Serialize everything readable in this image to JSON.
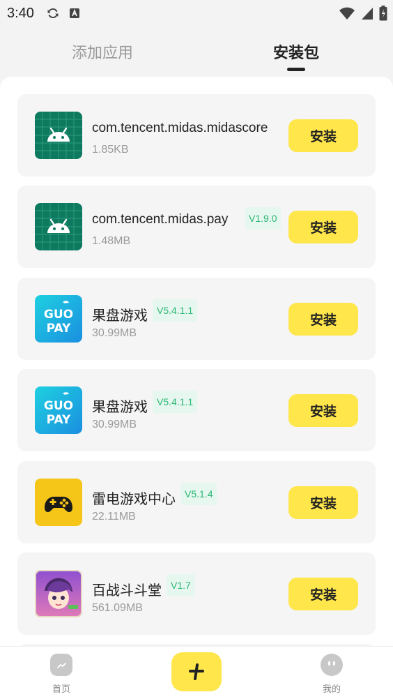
{
  "status_bar": {
    "time": "3:40"
  },
  "tabs": [
    {
      "label": "添加应用",
      "active": false
    },
    {
      "label": "安装包",
      "active": true
    }
  ],
  "apps": [
    {
      "name": "com.tencent.midas.midascore",
      "version": "",
      "size": "1.85KB",
      "icon": "android-icon",
      "install_label": "安装"
    },
    {
      "name": "com.tencent.midas.pay",
      "version": "V1.9.0",
      "size": "1.48MB",
      "icon": "android-icon",
      "install_label": "安装"
    },
    {
      "name": "果盘游戏",
      "version": "V5.4.1.1",
      "size": "30.99MB",
      "icon": "guopan-icon",
      "install_label": "安装"
    },
    {
      "name": "果盘游戏",
      "version": "V5.4.1.1",
      "size": "30.99MB",
      "icon": "guopan-icon",
      "install_label": "安装"
    },
    {
      "name": "雷电游戏中心",
      "version": "V5.1.4",
      "size": "22.11MB",
      "icon": "gamepad-icon",
      "install_label": "安装"
    },
    {
      "name": "百战斗斗堂",
      "version": "V1.7",
      "size": "561.09MB",
      "icon": "game-character-icon",
      "install_label": "安装"
    }
  ],
  "bottom_nav": {
    "home_label": "首页",
    "mine_label": "我的"
  },
  "colors": {
    "accent": "#ffe64a",
    "version_text": "#2bb673",
    "version_bg": "#e6f7ef",
    "android_bg": "#0d7a5f"
  }
}
